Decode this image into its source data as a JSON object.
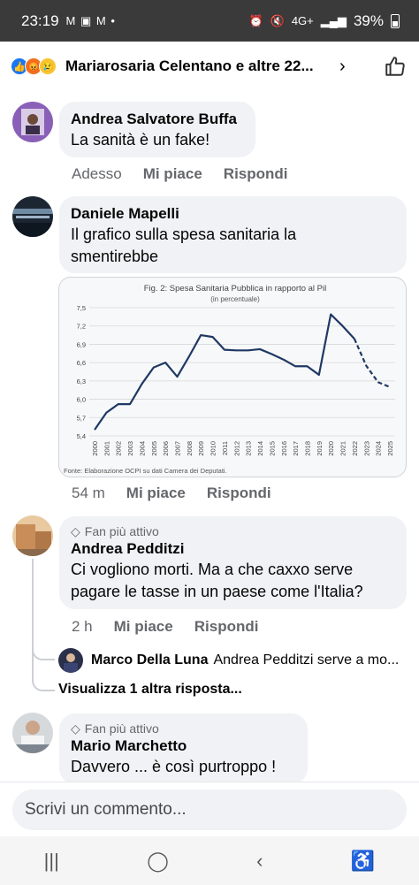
{
  "status": {
    "time": "23:19",
    "left_icons": "M ▣ M •",
    "network": "4G+",
    "battery": "39%"
  },
  "header": {
    "title": "Mariarosaria Celentano e altre 22...",
    "reactions": [
      "like",
      "angry",
      "sad"
    ]
  },
  "comments": [
    {
      "author": "Andrea Salvatore Buffa",
      "text": "La sanità è un fake!",
      "time": "Adesso",
      "like": "Mi piace",
      "reply": "Rispondi"
    },
    {
      "author": "Daniele Mapelli",
      "text_line1": "Il grafico sulla spesa sanitaria la",
      "text_line2": "smentirebbe",
      "time": "54 m",
      "like": "Mi piace",
      "reply": "Rispondi"
    },
    {
      "badge": "Fan più attivo",
      "author": "Andrea Pedditzi",
      "text_line1": "Ci vogliono morti. Ma a che caxxo serve",
      "text_line2": "pagare le tasse in un paese come l'Italia?",
      "time": "2 h",
      "like": "Mi piace",
      "reply": "Rispondi"
    },
    {
      "badge": "Fan più attivo",
      "author": "Mario Marchetto",
      "text": "Davvero ... è così purtroppo !"
    }
  ],
  "reply_preview": {
    "author": "Marco Della Luna",
    "text": "Andrea Pedditzi serve a mo..."
  },
  "more_replies": "Visualizza 1 altra risposta...",
  "composer": {
    "placeholder": "Scrivi un commento..."
  },
  "chart_data": {
    "type": "line",
    "title": "Fig. 2: Spesa Sanitaria Pubblica in rapporto al Pil",
    "subtitle": "(in percentuale)",
    "source": "Fonte: Elaborazione OCPI su dati Camera dei Deputati.",
    "ylim": [
      5.4,
      7.5
    ],
    "yticks": [
      "7,5",
      "7,2",
      "6,9",
      "6,6",
      "6,3",
      "6,0",
      "5,7",
      "5,4"
    ],
    "x": [
      "2000",
      "2001",
      "2002",
      "2003",
      "2004",
      "2005",
      "2006",
      "2007",
      "2008",
      "2009",
      "2010",
      "2011",
      "2012",
      "2013",
      "2014",
      "2015",
      "2016",
      "2017",
      "2018",
      "2019",
      "2020",
      "2021",
      "2022",
      "2023",
      "2024",
      "2025"
    ],
    "values": [
      5.5,
      5.78,
      5.92,
      5.92,
      6.25,
      6.52,
      6.6,
      6.37,
      6.7,
      7.05,
      7.02,
      6.81,
      6.8,
      6.8,
      6.82,
      6.74,
      6.65,
      6.54,
      6.54,
      6.4,
      7.39,
      7.2,
      6.99,
      6.55,
      6.28,
      6.2
    ],
    "projected_from_index": 22,
    "grid": true,
    "line_color": "#1f3864"
  }
}
